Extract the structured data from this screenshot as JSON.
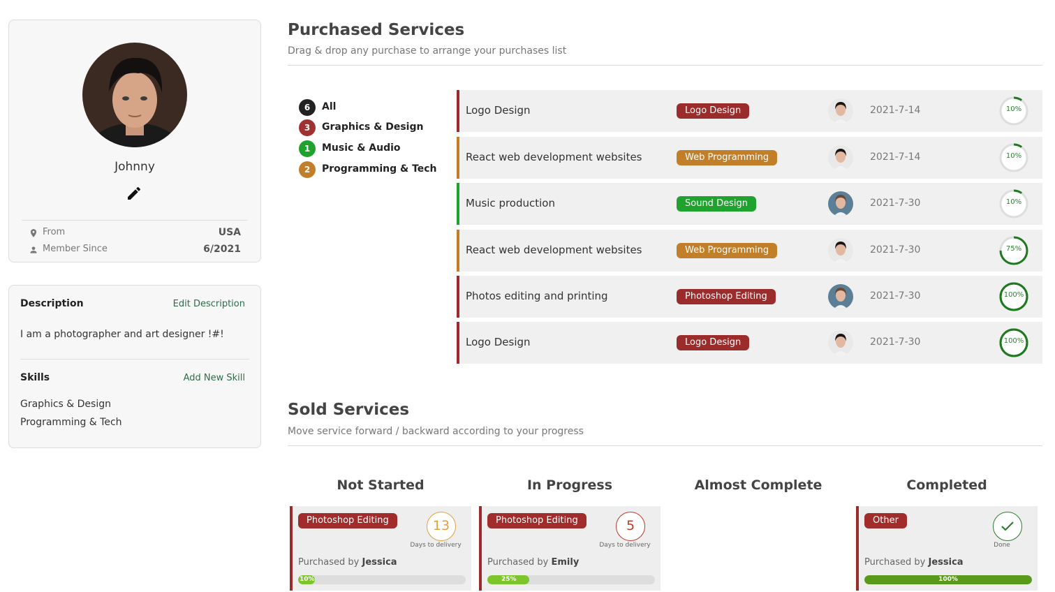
{
  "profile": {
    "name": "Johnny",
    "from_label": "From",
    "from_value": "USA",
    "member_label": "Member Since",
    "member_value": "6/2021"
  },
  "description": {
    "heading": "Description",
    "edit_link": "Edit Description",
    "text": "I am a photographer and art designer !#!"
  },
  "skills": {
    "heading": "Skills",
    "add_link": "Add New Skill",
    "items": [
      "Graphics & Design",
      "Programming & Tech"
    ]
  },
  "purchased": {
    "title": "Purchased Services",
    "subtitle": "Drag & drop any purchase to arrange your purchases list",
    "filters": [
      {
        "count": "6",
        "label": "All",
        "color": "#222222"
      },
      {
        "count": "3",
        "label": "Graphics & Design",
        "color": "#a03232"
      },
      {
        "count": "1",
        "label": "Music & Audio",
        "color": "#1fa22e"
      },
      {
        "count": "2",
        "label": "Programming & Tech",
        "color": "#c17f2a"
      }
    ],
    "rows": [
      {
        "title": "Logo Design",
        "tag": "Logo Design",
        "color": "#9b2c2c",
        "date": "2021-7-14",
        "progress_label": "10%",
        "progress": 0.1,
        "avatar": "woman-dark-hair"
      },
      {
        "title": "React web development websites",
        "tag": "Web Programming",
        "color": "#c17f2a",
        "date": "2021-7-14",
        "progress_label": "10%",
        "progress": 0.1,
        "avatar": "woman-dark-hair"
      },
      {
        "title": "Music production",
        "tag": "Sound Design",
        "color": "#1fa22e",
        "date": "2021-7-30",
        "progress_label": "10%",
        "progress": 0.1,
        "avatar": "woman-brown-hair"
      },
      {
        "title": "React web development websites",
        "tag": "Web Programming",
        "color": "#c17f2a",
        "date": "2021-7-30",
        "progress_label": "75%",
        "progress": 0.75,
        "avatar": "woman-dark-hair"
      },
      {
        "title": "Photos editing and printing",
        "tag": "Photoshop Editing",
        "color": "#9b2c2c",
        "date": "2021-7-30",
        "progress_label": "100%",
        "progress": 1.0,
        "avatar": "woman-brown-hair"
      },
      {
        "title": "Logo Design",
        "tag": "Logo Design",
        "color": "#9b2c2c",
        "date": "2021-7-30",
        "progress_label": "100%",
        "progress": 1.0,
        "avatar": "woman-dark-hair"
      }
    ]
  },
  "sold": {
    "title": "Sold Services",
    "subtitle": "Move service forward / backward according to your progress",
    "columns": [
      "Not Started",
      "In Progress",
      "Almost Complete",
      "Completed"
    ],
    "purchased_by_label": "Purchased by",
    "cards": [
      {
        "tag": "Photoshop Editing",
        "days": "13",
        "caption": "Days to delivery",
        "buyer": "Jessica",
        "progress_label": "10%",
        "progress": 0.1,
        "circle_color": "#e0a040",
        "status": "days"
      },
      {
        "tag": "Photoshop Editing",
        "days": "5",
        "caption": "Days to delivery",
        "buyer": "Emily",
        "progress_label": "25%",
        "progress": 0.25,
        "circle_color": "#c0392b",
        "status": "days"
      },
      {
        "tag": "Other",
        "days": "",
        "caption": "Done",
        "buyer": "Jessica",
        "progress_label": "100%",
        "progress": 1.0,
        "circle_color": "#2e7d32",
        "status": "done"
      }
    ]
  }
}
